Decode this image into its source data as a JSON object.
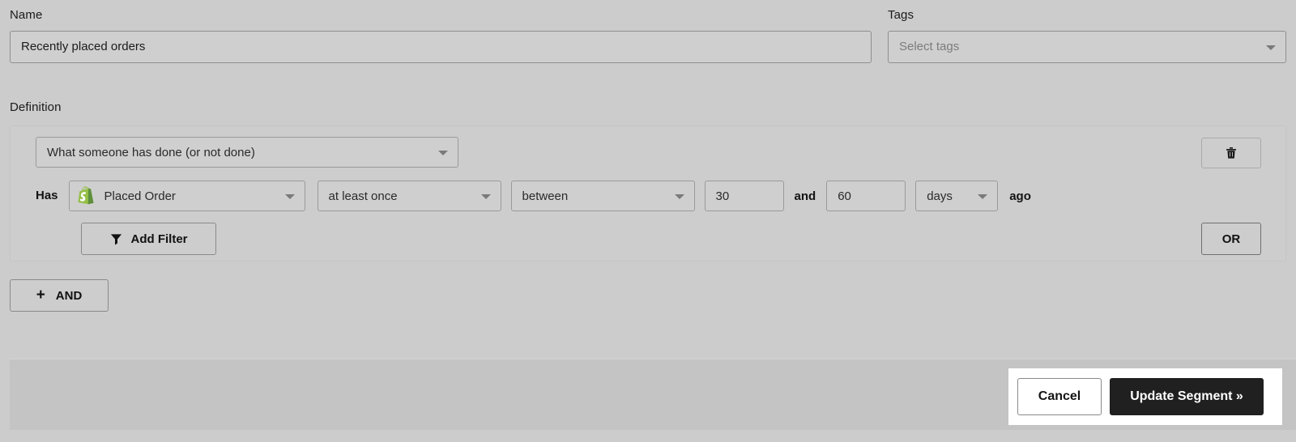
{
  "colors": {
    "page_background": "#cccccc",
    "panel_background": "#cdcdcd",
    "footer_background": "#c4c4c4",
    "control_background": "#cfcfcf",
    "control_border": "#9a9a9a",
    "primary_button_background": "#202020",
    "primary_button_text": "#ffffff",
    "focus_ring": "#ffffff",
    "shopify_green": "#95bf46",
    "shopify_green_dark": "#5e8e3e",
    "text_primary": "#1a1a1a",
    "placeholder_text": "#7c7c7c"
  },
  "name_field": {
    "label": "Name",
    "value": "Recently placed orders",
    "placeholder": "Name"
  },
  "tags_field": {
    "label": "Tags",
    "value": "",
    "placeholder": "Select tags",
    "caret_icon": "chevron-down-icon"
  },
  "definition": {
    "label": "Definition",
    "type_select": {
      "value": "What someone has done (or not done)",
      "caret_icon": "chevron-down-icon"
    },
    "delete_button": {
      "icon": "trash-icon",
      "label": ""
    },
    "filter_row": {
      "has_label": "Has",
      "metric": {
        "icon": "shopify-icon",
        "value": "Placed Order",
        "caret_icon": "chevron-down-icon"
      },
      "frequency": {
        "value": "at least once",
        "caret_icon": "chevron-down-icon"
      },
      "timeframe": {
        "value": "between",
        "caret_icon": "chevron-down-icon"
      },
      "from_value": "30",
      "conjunction": "and",
      "to_value": "60",
      "unit": {
        "value": "days",
        "caret_icon": "chevron-down-icon"
      },
      "suffix": "ago"
    },
    "add_filter_button": {
      "icon": "funnel-icon",
      "label": "Add Filter"
    },
    "or_button": {
      "label": "OR"
    }
  },
  "and_button": {
    "icon": "plus-icon",
    "label": "AND"
  },
  "footer": {
    "cancel_button": "Cancel",
    "update_button": "Update Segment »"
  }
}
